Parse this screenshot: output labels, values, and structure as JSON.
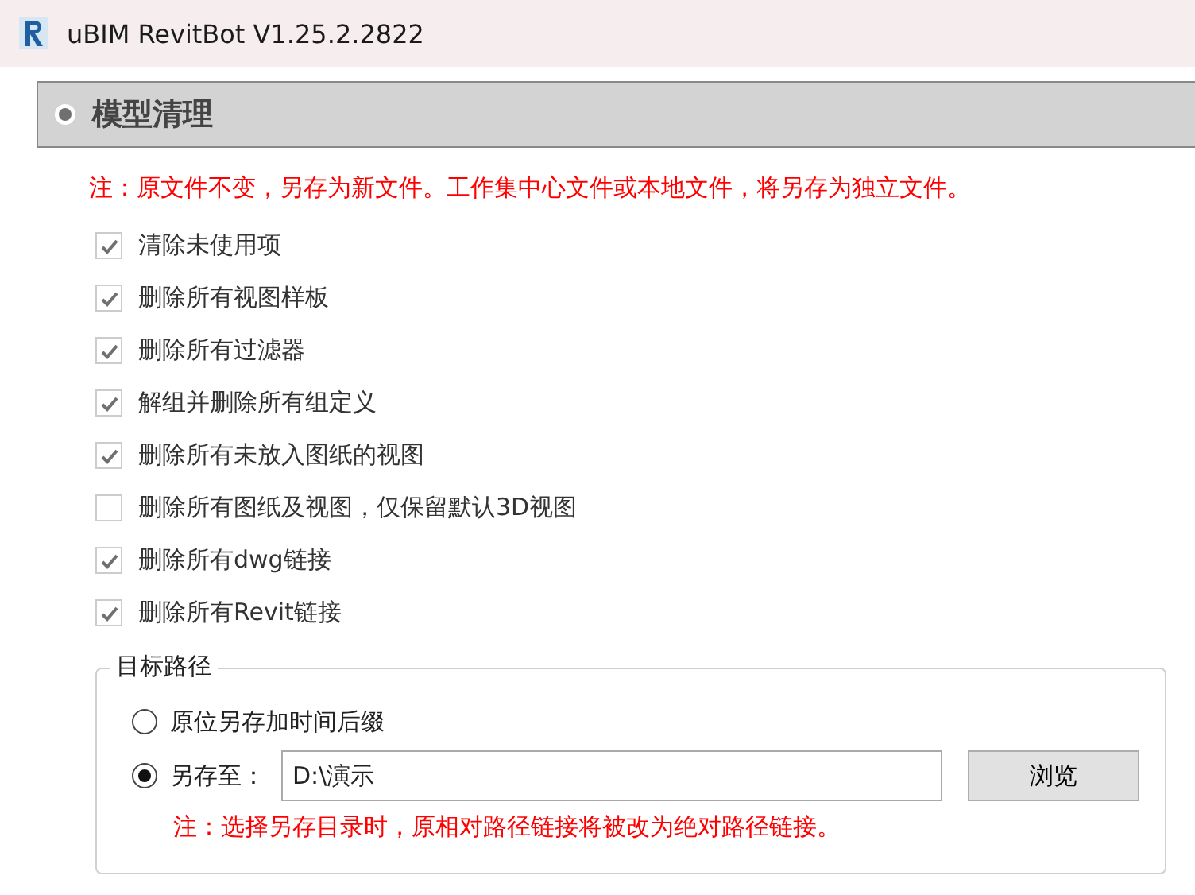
{
  "window": {
    "title": "uBIM RevitBot V1.25.2.2822"
  },
  "section": {
    "title": "模型清理"
  },
  "note": "注：原文件不变，另存为新文件。工作集中心文件或本地文件，将另存为独立文件。",
  "options": [
    {
      "label": "清除未使用项",
      "checked": true
    },
    {
      "label": "删除所有视图样板",
      "checked": true
    },
    {
      "label": "删除所有过滤器",
      "checked": true
    },
    {
      "label": "解组并删除所有组定义",
      "checked": true
    },
    {
      "label": "删除所有未放入图纸的视图",
      "checked": true
    },
    {
      "label": "删除所有图纸及视图，仅保留默认3D视图",
      "checked": false
    },
    {
      "label": "删除所有dwg链接",
      "checked": true
    },
    {
      "label": "删除所有Revit链接",
      "checked": true
    }
  ],
  "target": {
    "title": "目标路径",
    "choices": [
      {
        "label": "原位另存加时间后缀",
        "selected": false
      },
      {
        "label": "另存至：",
        "selected": true
      }
    ],
    "path": "D:\\演示",
    "browse": "浏览",
    "note": "注：选择另存目录时，原相对路径链接将被改为绝对路径链接。"
  }
}
